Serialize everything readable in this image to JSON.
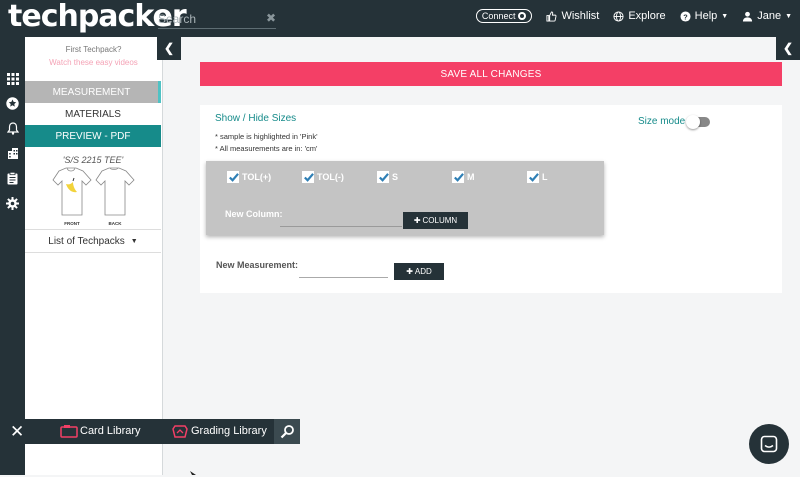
{
  "brand": {
    "logo_text": "techpacker"
  },
  "search": {
    "placeholder": "Search",
    "clear_glyph": "✖"
  },
  "topnav": {
    "connect": "Connect",
    "wishlist": "Wishlist",
    "explore": "Explore",
    "help": "Help",
    "user": "Jane"
  },
  "sidebar": {
    "first_techpack": "First Techpack?",
    "watch_videos": "Watch these easy videos",
    "measurement": "MEASUREMENT",
    "materials": "MATERIALS",
    "preview_pdf": "PREVIEW - PDF",
    "techpack_name": "'S/S 2215 TEE'",
    "front_label": "FRONT",
    "back_label": "BACK",
    "list_of_techpacks": "List of Techpacks"
  },
  "main": {
    "save_all": "SAVE ALL CHANGES",
    "show_hide_sizes": "Show / Hide Sizes",
    "note_pink": "* sample is highlighted in 'Pink'",
    "note_cm": "* All measurements are in: 'cm'",
    "size_mode": "Size mode",
    "size_mode_on": false,
    "columns": [
      {
        "label": "TOL(+)",
        "checked": true
      },
      {
        "label": "TOL(-)",
        "checked": true
      },
      {
        "label": "S",
        "checked": true
      },
      {
        "label": "M",
        "checked": true
      },
      {
        "label": "L",
        "checked": true
      }
    ],
    "new_column_label": "New Column:",
    "new_column_value": "",
    "column_button": "COLUMN",
    "new_measurement_label": "New Measurement:",
    "new_measurement_value": "",
    "add_button": "ADD"
  },
  "library": {
    "card_library": "Card Library",
    "grading_library": "Grading Library"
  },
  "colors": {
    "dark": "#253238",
    "teal": "#168b8a",
    "pink": "#f43f66",
    "check_blue": "#2f7fb5"
  }
}
